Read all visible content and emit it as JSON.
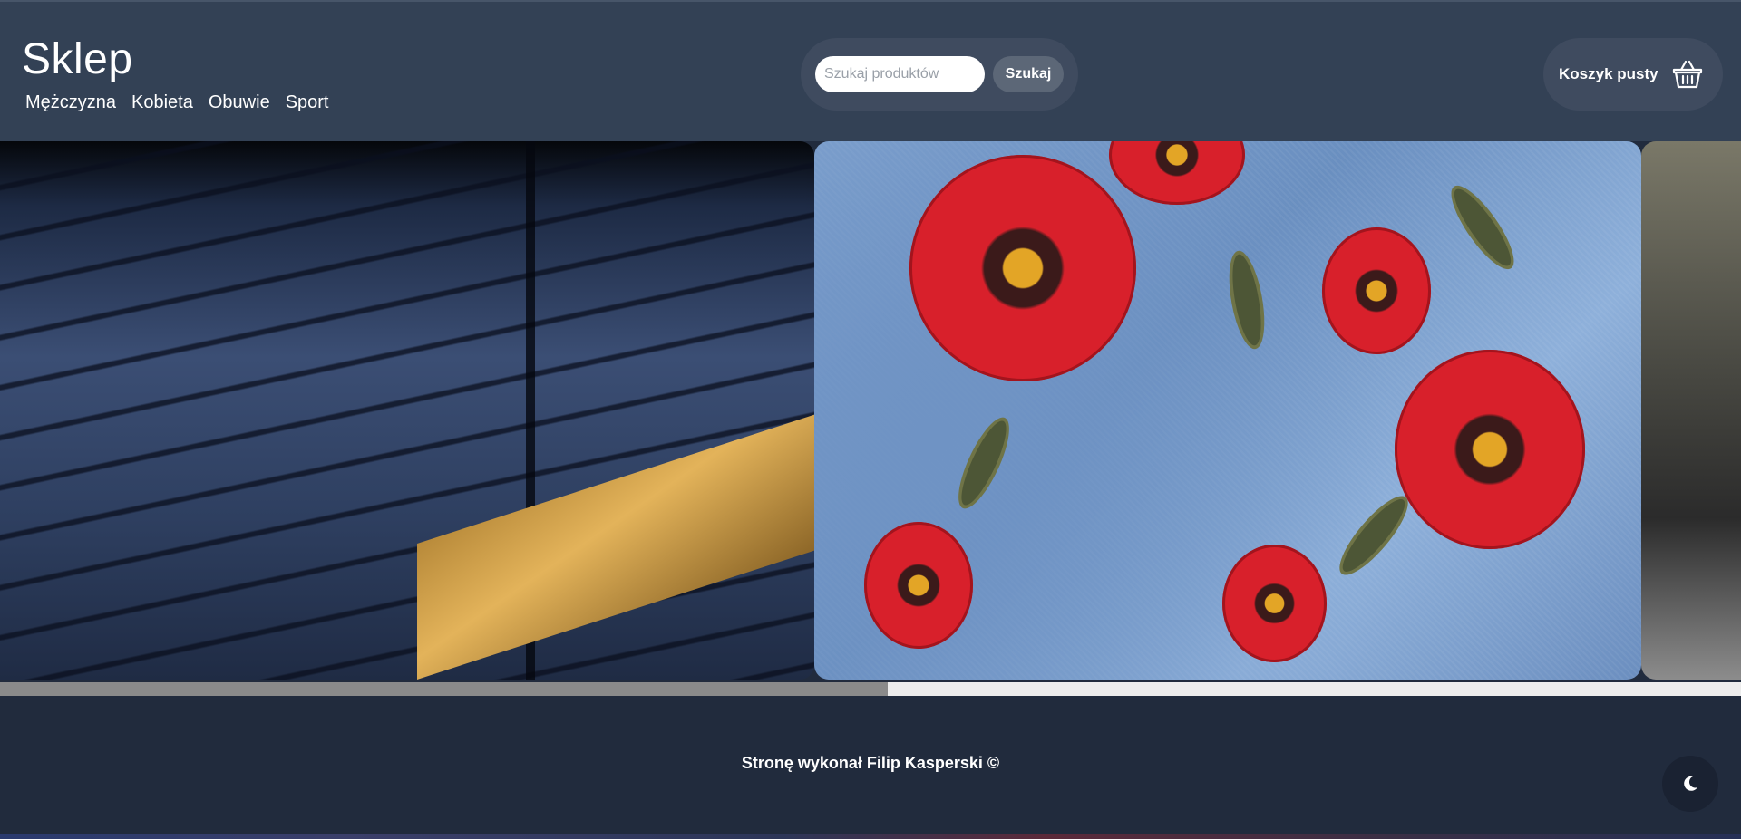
{
  "header": {
    "brand": "Sklep",
    "nav": [
      "Mężczyzna",
      "Kobieta",
      "Obuwie",
      "Sport"
    ],
    "search": {
      "placeholder": "Szukaj produktów",
      "value": "",
      "button_label": "Szukaj"
    },
    "cart": {
      "label": "Koszyk pusty",
      "icon": "basket-icon"
    }
  },
  "carousel": {
    "slides": [
      {
        "subject": "stacked-jeans"
      },
      {
        "subject": "embroidered-poppies-denim"
      },
      {
        "subject": "partial-slide"
      }
    ],
    "progress": 0.51
  },
  "footer": {
    "credit": "Stronę wykonał Filip Kasperski ©",
    "theme_toggle_icon": "moon-icon"
  },
  "colors": {
    "header_bg": "#334155",
    "page_bg": "#212b3d",
    "search_button_bg": "#5c6777"
  }
}
